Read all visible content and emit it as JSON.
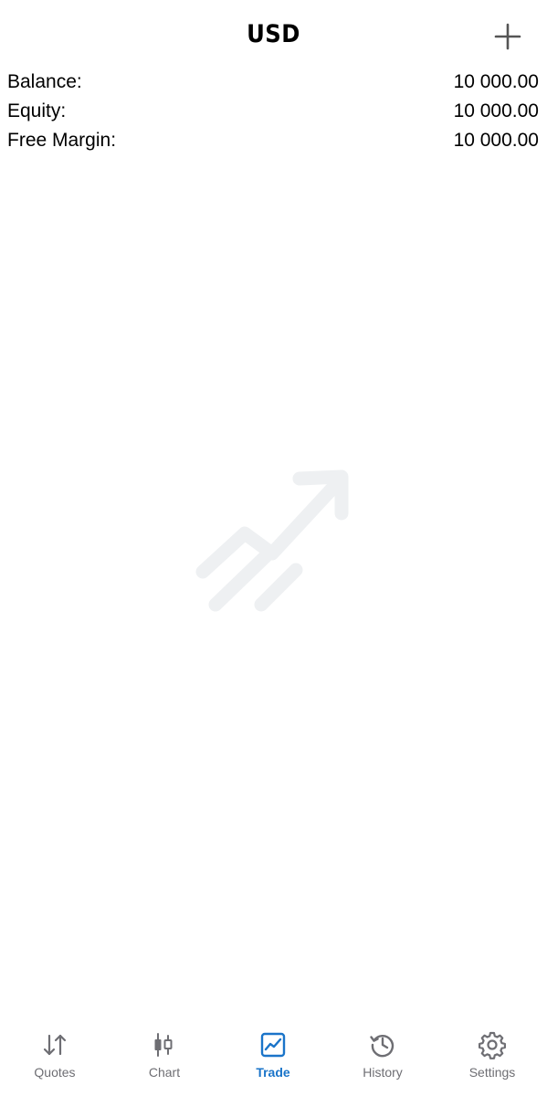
{
  "header": {
    "title": "USD",
    "add_icon": "plus-icon"
  },
  "summary": [
    {
      "label": "Balance:",
      "value": "10 000.00"
    },
    {
      "label": "Equity:",
      "value": "10 000.00"
    },
    {
      "label": "Free Margin:",
      "value": "10 000.00"
    }
  ],
  "empty_state": {
    "icon": "trending-up-icon",
    "color": "#eef0f2"
  },
  "tabbar": {
    "active_color": "#1a74c9",
    "inactive_color": "#6e6e73",
    "tabs": [
      {
        "label": "Quotes",
        "icon": "arrows-up-down-icon",
        "active": false
      },
      {
        "label": "Chart",
        "icon": "candlestick-icon",
        "active": false
      },
      {
        "label": "Trade",
        "icon": "trade-chart-icon",
        "active": true
      },
      {
        "label": "History",
        "icon": "history-icon",
        "active": false
      },
      {
        "label": "Settings",
        "icon": "gear-icon",
        "active": false
      }
    ]
  }
}
